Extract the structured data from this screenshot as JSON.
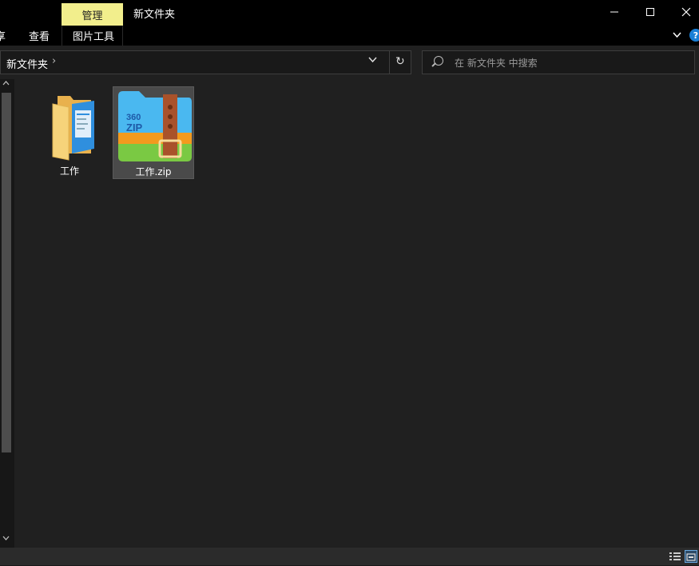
{
  "window": {
    "title": "新文件夹",
    "context_tab": "管理",
    "controls": {
      "minimize": "—",
      "maximize": "☐",
      "close": "✕"
    }
  },
  "ribbon": {
    "tabs": [
      "享",
      "查看",
      "图片工具"
    ],
    "help": "?"
  },
  "address_bar": {
    "path": "新文件夹",
    "separator": "›",
    "dropdown": "⌄",
    "refresh": "↻"
  },
  "search": {
    "placeholder": "在 新文件夹 中搜索"
  },
  "items": [
    {
      "name": "工作",
      "type": "folder",
      "selected": false
    },
    {
      "name": "工作.zip",
      "type": "zip-archive",
      "selected": true,
      "icon_text": "360 ZIP"
    }
  ],
  "colors": {
    "manage_tab": "#f2ee8c",
    "background": "#202020",
    "selection": "#4a4a4a",
    "folder": "#f4c868",
    "zip_blue": "#4ab8f0",
    "zip_orange": "#f39a1e",
    "zip_green": "#7ac943",
    "zip_strap": "#a9522a"
  }
}
